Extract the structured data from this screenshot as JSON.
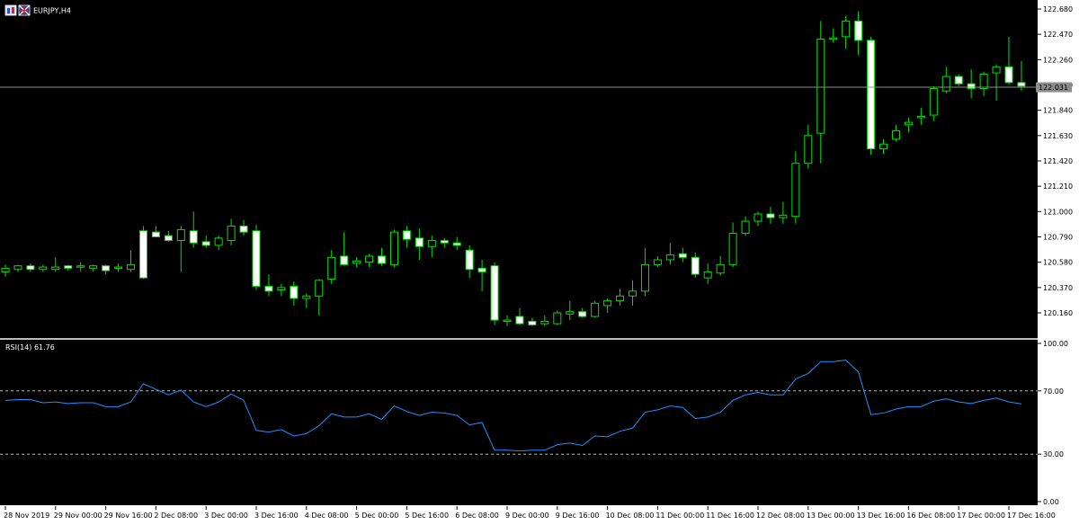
{
  "window": {
    "symbol_label": "EURJPY,H4",
    "icons": [
      "chart-window-icon",
      "flag-icon"
    ]
  },
  "colors": {
    "background": "#000000",
    "bull_body": "#000000",
    "bull_wick": "#00e000",
    "bear_body": "#ffffff",
    "bear_wick": "#00e000",
    "rsi_line": "#1e90ff",
    "axis_panel": "#ffffff",
    "current_price_line": "#8c8c8c"
  },
  "price_panel": {
    "current_price_label": "122.031",
    "current_price": 122.031
  },
  "rsi_panel": {
    "label": "RSI(14) 61.76"
  },
  "chart_data": [
    {
      "type": "candlestick",
      "symbol": "EURJPY",
      "timeframe": "H4",
      "ylim": [
        120.05,
        122.66
      ],
      "yticks": [
        "122.680",
        "122.470",
        "122.260",
        "122.050",
        "121.840",
        "121.630",
        "121.420",
        "121.210",
        "121.000",
        "120.790",
        "120.580",
        "120.370",
        "120.160"
      ],
      "ytick_values": [
        122.68,
        122.47,
        122.26,
        122.05,
        121.84,
        121.63,
        121.42,
        121.21,
        121.0,
        120.79,
        120.58,
        120.37,
        120.16
      ],
      "xlabels": [
        "28 Nov 2019",
        "29 Nov 00:00",
        "29 Nov 16:00",
        "2 Dec 08:00",
        "3 Dec 00:00",
        "3 Dec 16:00",
        "4 Dec 08:00",
        "5 Dec 00:00",
        "5 Dec 16:00",
        "6 Dec 08:00",
        "9 Dec 00:00",
        "9 Dec 16:00",
        "10 Dec 08:00",
        "11 Dec 00:00",
        "11 Dec 16:00",
        "12 Dec 08:00",
        "13 Dec 00:00",
        "13 Dec 16:00",
        "16 Dec 08:00",
        "17 Dec 00:00",
        "17 Dec 16:00"
      ],
      "xlabel_candle_index": [
        0,
        4,
        8,
        12,
        16,
        20,
        24,
        28,
        32,
        36,
        40,
        44,
        48,
        52,
        56,
        60,
        64,
        68,
        72,
        76,
        80
      ],
      "candles": [
        {
          "o": 120.5,
          "h": 120.56,
          "l": 120.46,
          "c": 120.53
        },
        {
          "o": 120.52,
          "h": 120.56,
          "l": 120.5,
          "c": 120.55
        },
        {
          "o": 120.55,
          "h": 120.57,
          "l": 120.5,
          "c": 120.52
        },
        {
          "o": 120.52,
          "h": 120.56,
          "l": 120.5,
          "c": 120.54
        },
        {
          "o": 120.52,
          "h": 120.62,
          "l": 120.5,
          "c": 120.54
        },
        {
          "o": 120.55,
          "h": 120.56,
          "l": 120.51,
          "c": 120.53
        },
        {
          "o": 120.54,
          "h": 120.58,
          "l": 120.5,
          "c": 120.55
        },
        {
          "o": 120.53,
          "h": 120.56,
          "l": 120.5,
          "c": 120.55
        },
        {
          "o": 120.55,
          "h": 120.56,
          "l": 120.48,
          "c": 120.51
        },
        {
          "o": 120.53,
          "h": 120.57,
          "l": 120.5,
          "c": 120.54
        },
        {
          "o": 120.52,
          "h": 120.68,
          "l": 120.5,
          "c": 120.56
        },
        {
          "o": 120.84,
          "h": 120.88,
          "l": 120.44,
          "c": 120.45
        },
        {
          "o": 120.83,
          "h": 120.88,
          "l": 120.8,
          "c": 120.79
        },
        {
          "o": 120.8,
          "h": 120.84,
          "l": 120.75,
          "c": 120.76
        },
        {
          "o": 120.76,
          "h": 120.88,
          "l": 120.5,
          "c": 120.85
        },
        {
          "o": 120.84,
          "h": 121.0,
          "l": 120.7,
          "c": 120.74
        },
        {
          "o": 120.75,
          "h": 120.8,
          "l": 120.7,
          "c": 120.72
        },
        {
          "o": 120.72,
          "h": 120.8,
          "l": 120.68,
          "c": 120.78
        },
        {
          "o": 120.76,
          "h": 120.94,
          "l": 120.72,
          "c": 120.88
        },
        {
          "o": 120.88,
          "h": 120.93,
          "l": 120.8,
          "c": 120.83
        },
        {
          "o": 120.84,
          "h": 120.89,
          "l": 120.35,
          "c": 120.38
        },
        {
          "o": 120.38,
          "h": 120.48,
          "l": 120.3,
          "c": 120.34
        },
        {
          "o": 120.35,
          "h": 120.4,
          "l": 120.3,
          "c": 120.37
        },
        {
          "o": 120.38,
          "h": 120.42,
          "l": 120.22,
          "c": 120.28
        },
        {
          "o": 120.28,
          "h": 120.32,
          "l": 120.2,
          "c": 120.3
        },
        {
          "o": 120.3,
          "h": 120.44,
          "l": 120.14,
          "c": 120.43
        },
        {
          "o": 120.44,
          "h": 120.68,
          "l": 120.4,
          "c": 120.62
        },
        {
          "o": 120.63,
          "h": 120.83,
          "l": 120.55,
          "c": 120.56
        },
        {
          "o": 120.57,
          "h": 120.62,
          "l": 120.54,
          "c": 120.59
        },
        {
          "o": 120.58,
          "h": 120.65,
          "l": 120.54,
          "c": 120.63
        },
        {
          "o": 120.63,
          "h": 120.7,
          "l": 120.55,
          "c": 120.57
        },
        {
          "o": 120.56,
          "h": 120.85,
          "l": 120.54,
          "c": 120.83
        },
        {
          "o": 120.84,
          "h": 120.88,
          "l": 120.7,
          "c": 120.77
        },
        {
          "o": 120.78,
          "h": 120.86,
          "l": 120.6,
          "c": 120.71
        },
        {
          "o": 120.71,
          "h": 120.8,
          "l": 120.62,
          "c": 120.76
        },
        {
          "o": 120.76,
          "h": 120.78,
          "l": 120.7,
          "c": 120.74
        },
        {
          "o": 120.74,
          "h": 120.79,
          "l": 120.68,
          "c": 120.72
        },
        {
          "o": 120.68,
          "h": 120.72,
          "l": 120.45,
          "c": 120.52
        },
        {
          "o": 120.53,
          "h": 120.6,
          "l": 120.34,
          "c": 120.5
        },
        {
          "o": 120.55,
          "h": 120.58,
          "l": 120.06,
          "c": 120.1
        },
        {
          "o": 120.1,
          "h": 120.14,
          "l": 120.05,
          "c": 120.1
        },
        {
          "o": 120.13,
          "h": 120.2,
          "l": 120.06,
          "c": 120.07
        },
        {
          "o": 120.09,
          "h": 120.12,
          "l": 120.05,
          "c": 120.06
        },
        {
          "o": 120.07,
          "h": 120.14,
          "l": 120.05,
          "c": 120.09
        },
        {
          "o": 120.07,
          "h": 120.18,
          "l": 120.06,
          "c": 120.16
        },
        {
          "o": 120.15,
          "h": 120.26,
          "l": 120.1,
          "c": 120.17
        },
        {
          "o": 120.17,
          "h": 120.2,
          "l": 120.12,
          "c": 120.13
        },
        {
          "o": 120.13,
          "h": 120.26,
          "l": 120.12,
          "c": 120.24
        },
        {
          "o": 120.22,
          "h": 120.28,
          "l": 120.16,
          "c": 120.26
        },
        {
          "o": 120.26,
          "h": 120.36,
          "l": 120.22,
          "c": 120.3
        },
        {
          "o": 120.3,
          "h": 120.43,
          "l": 120.22,
          "c": 120.34
        },
        {
          "o": 120.34,
          "h": 120.7,
          "l": 120.3,
          "c": 120.56
        },
        {
          "o": 120.56,
          "h": 120.63,
          "l": 120.54,
          "c": 120.6
        },
        {
          "o": 120.6,
          "h": 120.74,
          "l": 120.56,
          "c": 120.64
        },
        {
          "o": 120.65,
          "h": 120.7,
          "l": 120.58,
          "c": 120.62
        },
        {
          "o": 120.62,
          "h": 120.66,
          "l": 120.45,
          "c": 120.48
        },
        {
          "o": 120.45,
          "h": 120.57,
          "l": 120.4,
          "c": 120.5
        },
        {
          "o": 120.49,
          "h": 120.63,
          "l": 120.47,
          "c": 120.56
        },
        {
          "o": 120.56,
          "h": 120.91,
          "l": 120.54,
          "c": 120.82
        },
        {
          "o": 120.82,
          "h": 120.96,
          "l": 120.8,
          "c": 120.92
        },
        {
          "o": 120.92,
          "h": 121.0,
          "l": 120.88,
          "c": 120.98
        },
        {
          "o": 120.98,
          "h": 121.04,
          "l": 120.9,
          "c": 120.95
        },
        {
          "o": 120.95,
          "h": 121.08,
          "l": 120.9,
          "c": 120.97
        },
        {
          "o": 120.96,
          "h": 121.5,
          "l": 120.9,
          "c": 121.4
        },
        {
          "o": 121.4,
          "h": 121.72,
          "l": 121.36,
          "c": 121.63
        },
        {
          "o": 121.65,
          "h": 122.58,
          "l": 121.4,
          "c": 122.43
        },
        {
          "o": 122.43,
          "h": 122.52,
          "l": 122.4,
          "c": 122.44
        },
        {
          "o": 122.45,
          "h": 122.62,
          "l": 122.35,
          "c": 122.58
        },
        {
          "o": 122.58,
          "h": 122.66,
          "l": 122.3,
          "c": 122.42
        },
        {
          "o": 122.42,
          "h": 122.45,
          "l": 121.47,
          "c": 121.52
        },
        {
          "o": 121.52,
          "h": 121.6,
          "l": 121.48,
          "c": 121.56
        },
        {
          "o": 121.6,
          "h": 121.72,
          "l": 121.58,
          "c": 121.67
        },
        {
          "o": 121.72,
          "h": 121.78,
          "l": 121.66,
          "c": 121.74
        },
        {
          "o": 121.78,
          "h": 121.86,
          "l": 121.72,
          "c": 121.79
        },
        {
          "o": 121.8,
          "h": 122.04,
          "l": 121.75,
          "c": 122.02
        },
        {
          "o": 122.0,
          "h": 122.2,
          "l": 121.98,
          "c": 122.12
        },
        {
          "o": 122.12,
          "h": 122.14,
          "l": 122.04,
          "c": 122.06
        },
        {
          "o": 122.06,
          "h": 122.18,
          "l": 121.94,
          "c": 122.02
        },
        {
          "o": 122.02,
          "h": 122.16,
          "l": 121.96,
          "c": 122.14
        },
        {
          "o": 122.15,
          "h": 122.22,
          "l": 121.92,
          "c": 122.2
        },
        {
          "o": 122.2,
          "h": 122.45,
          "l": 122.05,
          "c": 122.07
        },
        {
          "o": 122.07,
          "h": 122.25,
          "l": 122.0,
          "c": 122.04
        }
      ]
    },
    {
      "type": "line",
      "series": [
        {
          "name": "RSI(14)",
          "values": [
            64,
            64.5,
            64.5,
            62.5,
            63,
            62,
            62.5,
            62.5,
            60,
            60,
            63,
            74.5,
            71,
            67.5,
            70.5,
            63,
            60,
            63,
            68,
            64,
            45,
            44,
            45.5,
            41.5,
            43,
            48,
            55.5,
            53.5,
            53.5,
            55.5,
            52,
            60.5,
            57,
            54.5,
            56.5,
            56,
            54.5,
            48.5,
            50,
            32.5,
            32.5,
            32,
            32.5,
            32.5,
            36,
            37,
            35.5,
            41.5,
            41,
            44.5,
            46.5,
            56.5,
            58,
            60.5,
            59.5,
            52.5,
            53.5,
            56.5,
            64,
            67.5,
            69,
            67.5,
            67.5,
            77.5,
            81,
            88.5,
            88.5,
            89.5,
            82,
            55,
            56,
            58.5,
            60,
            60,
            63.5,
            65,
            63,
            62,
            64,
            65.5,
            63,
            61.76
          ]
        }
      ],
      "ylim": [
        0,
        100
      ],
      "yticks": [
        "100.00",
        "70.00",
        "30.00",
        "0.00"
      ],
      "ytick_values": [
        100,
        70,
        30,
        0
      ],
      "levels": [
        70,
        30
      ]
    }
  ]
}
